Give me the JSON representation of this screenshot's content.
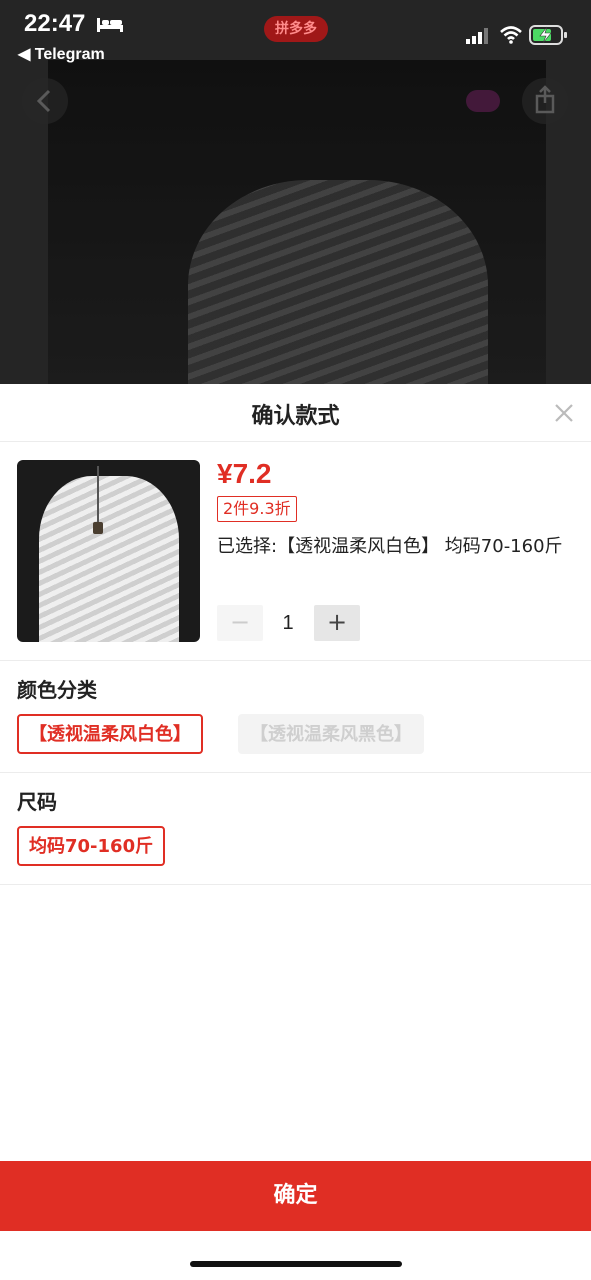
{
  "status_bar": {
    "time": "22:47",
    "back_app": "◀ Telegram",
    "app_badge": "拼多多"
  },
  "sheet": {
    "title": "确认款式",
    "price": "¥7.2",
    "discount_tag": "2件9.3折",
    "selected_text": "已选择:【透视温柔风白色】 均码70-160斤",
    "quantity": {
      "minus": "−",
      "value": "1",
      "plus": "+"
    },
    "color_section": {
      "title": "颜色分类",
      "options": [
        "【透视温柔风白色】",
        "【透视温柔风黑色】"
      ],
      "selected_index": 0,
      "disabled_index": 1
    },
    "size_section": {
      "title": "尺码",
      "options": [
        "均码70-160斤"
      ],
      "selected_index": 0
    },
    "confirm_label": "确定"
  },
  "colors": {
    "accent": "#e02e24",
    "disabled_bg": "#f3f3f3"
  },
  "icons": [
    "bed-icon",
    "signal-icon",
    "wifi-icon",
    "battery-charging-icon",
    "back-arrow-icon",
    "share-icon",
    "close-icon"
  ]
}
